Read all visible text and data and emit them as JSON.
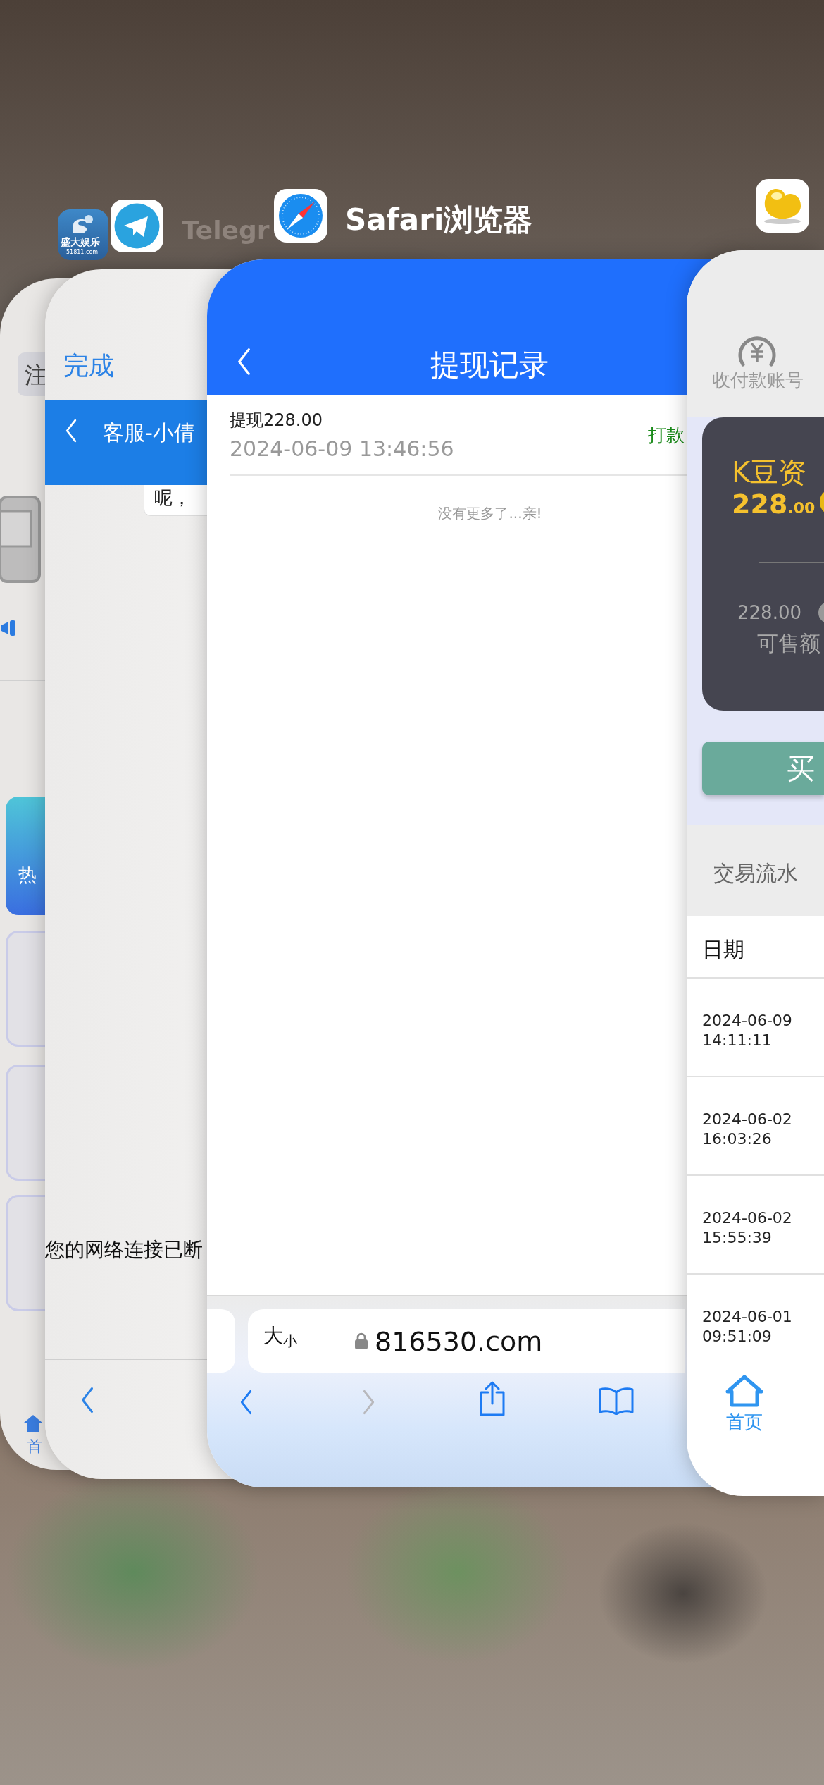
{
  "game_app": {
    "icon_caption": "盛大娱乐",
    "icon_domain": "51811.com",
    "tab_label": "注",
    "banner_label": "热",
    "nav_label": "首"
  },
  "telegram_app": {
    "name": "Telegr",
    "done_button": "完成",
    "chat_title": "客服-小倩",
    "message": "呢，",
    "notice": "您的网络连接已断"
  },
  "safari_app": {
    "name": "Safari浏览器",
    "page_title": "提现记录",
    "records": [
      {
        "title": "提现228.00",
        "time": "2024-06-09 13:46:56",
        "status": "打款"
      }
    ],
    "end_note": "没有更多了...亲!",
    "text_size_button": "大$_{小}$",
    "url": "816530.com",
    "toolbar": [
      {
        "kind": "back",
        "disabled": false
      },
      {
        "kind": "forward",
        "disabled": true
      },
      {
        "kind": "share",
        "disabled": false
      },
      {
        "kind": "bookmarks",
        "disabled": false
      }
    ]
  },
  "bean_app": {
    "account_label": "收付款账号",
    "asset_label": "K豆资",
    "asset_amount": "228",
    "asset_decimals": ".00",
    "sellable_amount": "228.00",
    "sellable_label": "可售额",
    "buy_button": "买",
    "ledger_title": "交易流水",
    "date_column": "日期",
    "rows": [
      {
        "date": "2024-06-09",
        "time": "14:11:11"
      },
      {
        "date": "2024-06-02",
        "time": "16:03:26"
      },
      {
        "date": "2024-06-02",
        "time": "15:55:39"
      },
      {
        "date": "2024-06-01",
        "time": "09:51:09"
      }
    ],
    "nav": [
      {
        "label": "首页",
        "selected": true
      }
    ]
  }
}
